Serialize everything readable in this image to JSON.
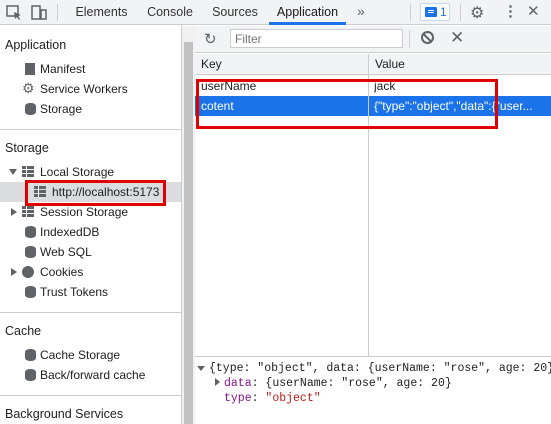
{
  "tabs": [
    {
      "label": "Elements"
    },
    {
      "label": "Console"
    },
    {
      "label": "Sources"
    },
    {
      "label": "Application"
    }
  ],
  "issues_count": "1",
  "sidebar": {
    "application_title": "Application",
    "application_items": [
      {
        "label": "Manifest",
        "icon": "document-icon"
      },
      {
        "label": "Service Workers",
        "icon": "gear-icon"
      },
      {
        "label": "Storage",
        "icon": "database-icon"
      }
    ],
    "storage_title": "Storage",
    "storage_items": [
      {
        "label": "Local Storage",
        "icon": "grid-icon",
        "expanded": true
      },
      {
        "label": "http://localhost:5173",
        "icon": "grid-icon",
        "selected": true
      },
      {
        "label": "Session Storage",
        "icon": "grid-icon",
        "expanded": false
      },
      {
        "label": "IndexedDB",
        "icon": "database-icon"
      },
      {
        "label": "Web SQL",
        "icon": "database-icon"
      },
      {
        "label": "Cookies",
        "icon": "cookie-icon",
        "expanded": false
      },
      {
        "label": "Trust Tokens",
        "icon": "database-icon"
      }
    ],
    "cache_title": "Cache",
    "cache_items": [
      {
        "label": "Cache Storage",
        "icon": "database-icon"
      },
      {
        "label": "Back/forward cache",
        "icon": "database-icon"
      }
    ],
    "background_title": "Background Services"
  },
  "main": {
    "filter_placeholder": "Filter",
    "columns": {
      "key": "Key",
      "value": "Value"
    },
    "rows": [
      {
        "key": "userName",
        "value": "jack"
      },
      {
        "key": "cotent",
        "value": "{\"type\":\"object\",\"data\":{\"user..."
      }
    ],
    "preview": {
      "line1": "{type: \"object\", data: {userName: \"rose\", age: 20}}",
      "line2_key": "data",
      "line2_rest": ": {userName: \"rose\", age: 20}",
      "line3_key": "type",
      "line3_sep": ": ",
      "line3_val": "\"object\""
    }
  },
  "colors": {
    "accent": "#1a73e8",
    "annotation": "#e00000"
  }
}
